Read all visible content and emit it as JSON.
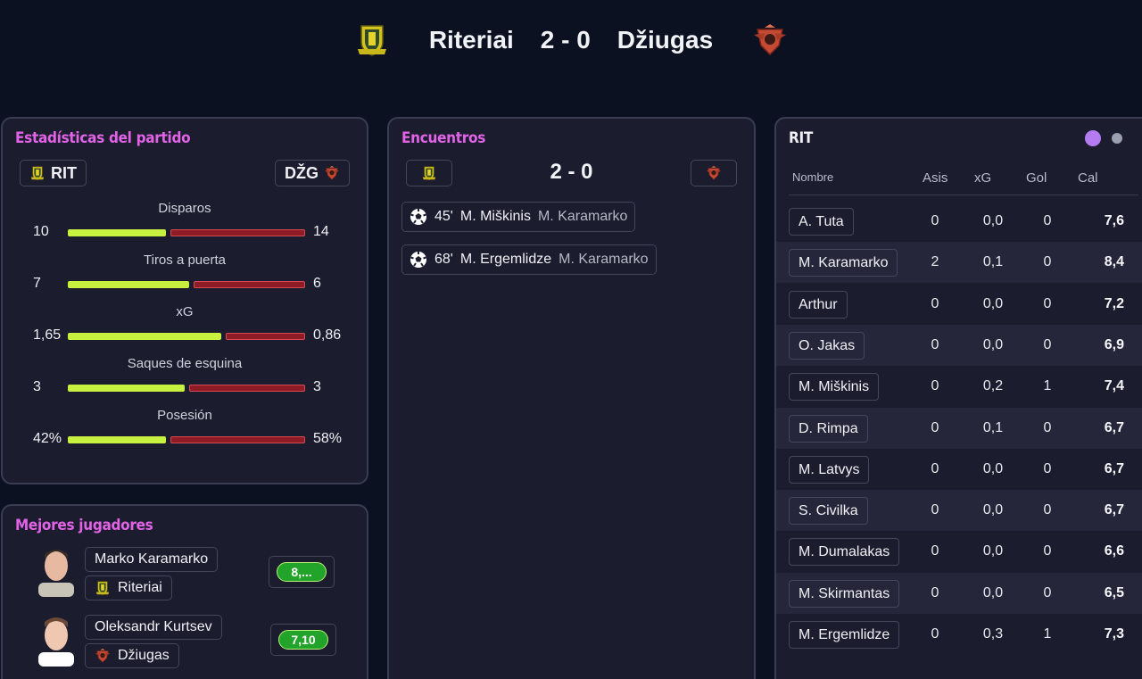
{
  "match": {
    "home_team": "Riteriai",
    "away_team": "Džiugas",
    "score": "2 - 0"
  },
  "stats_panel": {
    "title": "Estadísticas del partido",
    "home_abbr": "RIT",
    "away_abbr": "DŽG",
    "stats": [
      {
        "label": "Disparos",
        "home": "10",
        "away": "14",
        "home_frac": 0.42
      },
      {
        "label": "Tiros a puerta",
        "home": "7",
        "away": "6",
        "home_frac": 0.52
      },
      {
        "label": "xG",
        "home": "1,65",
        "away": "0,86",
        "home_frac": 0.66
      },
      {
        "label": "Saques de esquina",
        "home": "3",
        "away": "3",
        "home_frac": 0.5
      },
      {
        "label": "Posesión",
        "home": "42%",
        "away": "58%",
        "home_frac": 0.42
      }
    ]
  },
  "encounters_panel": {
    "title": "Encuentros",
    "score": "2 - 0",
    "events": [
      {
        "minute": "45'",
        "scorer": "M. Miškinis",
        "assist": "M. Karamarko",
        "icon": "soccer-ball-icon"
      },
      {
        "minute": "68'",
        "scorer": "M. Ergemlidze",
        "assist": "M. Karamarko",
        "icon": "soccer-ball-icon"
      }
    ]
  },
  "best_players_panel": {
    "title": "Mejores jugadores",
    "players": [
      {
        "name": "Marko Karamarko",
        "team": "Riteriai",
        "rating": "8,..."
      },
      {
        "name": "Oleksandr Kurtsev",
        "team": "Džiugas",
        "rating": "7,10"
      }
    ]
  },
  "lineup_panel": {
    "title": "RIT",
    "columns": [
      "Nombre",
      "Asis",
      "xG",
      "Gol",
      "Cal"
    ],
    "rows": [
      {
        "name": "A. Tuta",
        "asis": "0",
        "xg": "0,0",
        "gol": "0",
        "cal": "7,6"
      },
      {
        "name": "M. Karamarko",
        "asis": "2",
        "xg": "0,1",
        "gol": "0",
        "cal": "8,4"
      },
      {
        "name": "Arthur",
        "asis": "0",
        "xg": "0,0",
        "gol": "0",
        "cal": "7,2"
      },
      {
        "name": "O. Jakas",
        "asis": "0",
        "xg": "0,0",
        "gol": "0",
        "cal": "6,9"
      },
      {
        "name": "M. Miškinis",
        "asis": "0",
        "xg": "0,2",
        "gol": "1",
        "cal": "7,4"
      },
      {
        "name": "D. Rimpa",
        "asis": "0",
        "xg": "0,1",
        "gol": "0",
        "cal": "6,7"
      },
      {
        "name": "M. Latvys",
        "asis": "0",
        "xg": "0,0",
        "gol": "0",
        "cal": "6,7"
      },
      {
        "name": "S. Civilka",
        "asis": "0",
        "xg": "0,0",
        "gol": "0",
        "cal": "6,7"
      },
      {
        "name": "M. Dumalakas",
        "asis": "0",
        "xg": "0,0",
        "gol": "0",
        "cal": "6,6"
      },
      {
        "name": "M. Skirmantas",
        "asis": "0",
        "xg": "0,0",
        "gol": "0",
        "cal": "6,5"
      },
      {
        "name": "M. Ergemlidze",
        "asis": "0",
        "xg": "0,3",
        "gol": "1",
        "cal": "7,3"
      }
    ]
  },
  "colors": {
    "accent_title": "#e163e6",
    "home_bar": "#c8f03e",
    "away_bar": "#8f1b26",
    "rating_green": "#22a32a",
    "toggle_active": "#b57bf0",
    "toggle_inactive": "#9aa0ad"
  }
}
